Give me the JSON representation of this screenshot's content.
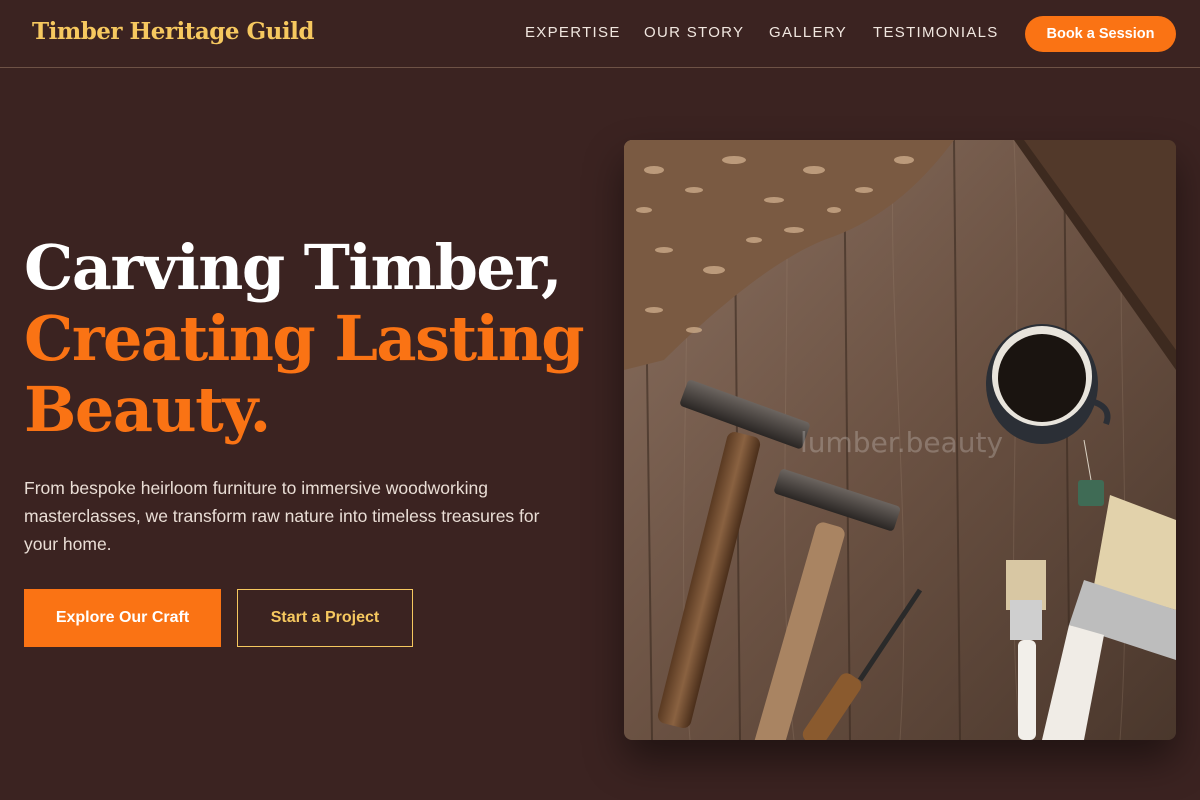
{
  "header": {
    "logo": "Timber Heritage Guild",
    "nav": [
      "EXPERTISE",
      "OUR STORY",
      "GALLERY",
      "TESTIMONIALS"
    ],
    "cta": "Book a Session"
  },
  "hero": {
    "title_line1": "Carving Timber,",
    "title_line2": "Creating Lasting",
    "title_line3": "Beauty.",
    "description": "From bespoke heirloom furniture to immersive woodworking masterclasses, we transform raw nature into timeless treasures for your home.",
    "primary_button": "Explore Our Craft",
    "secondary_button": "Start a Project",
    "image_watermark": "lumber.beauty"
  },
  "colors": {
    "background": "#3b2321",
    "accent": "#fa7314",
    "gold": "#f6c85f"
  }
}
